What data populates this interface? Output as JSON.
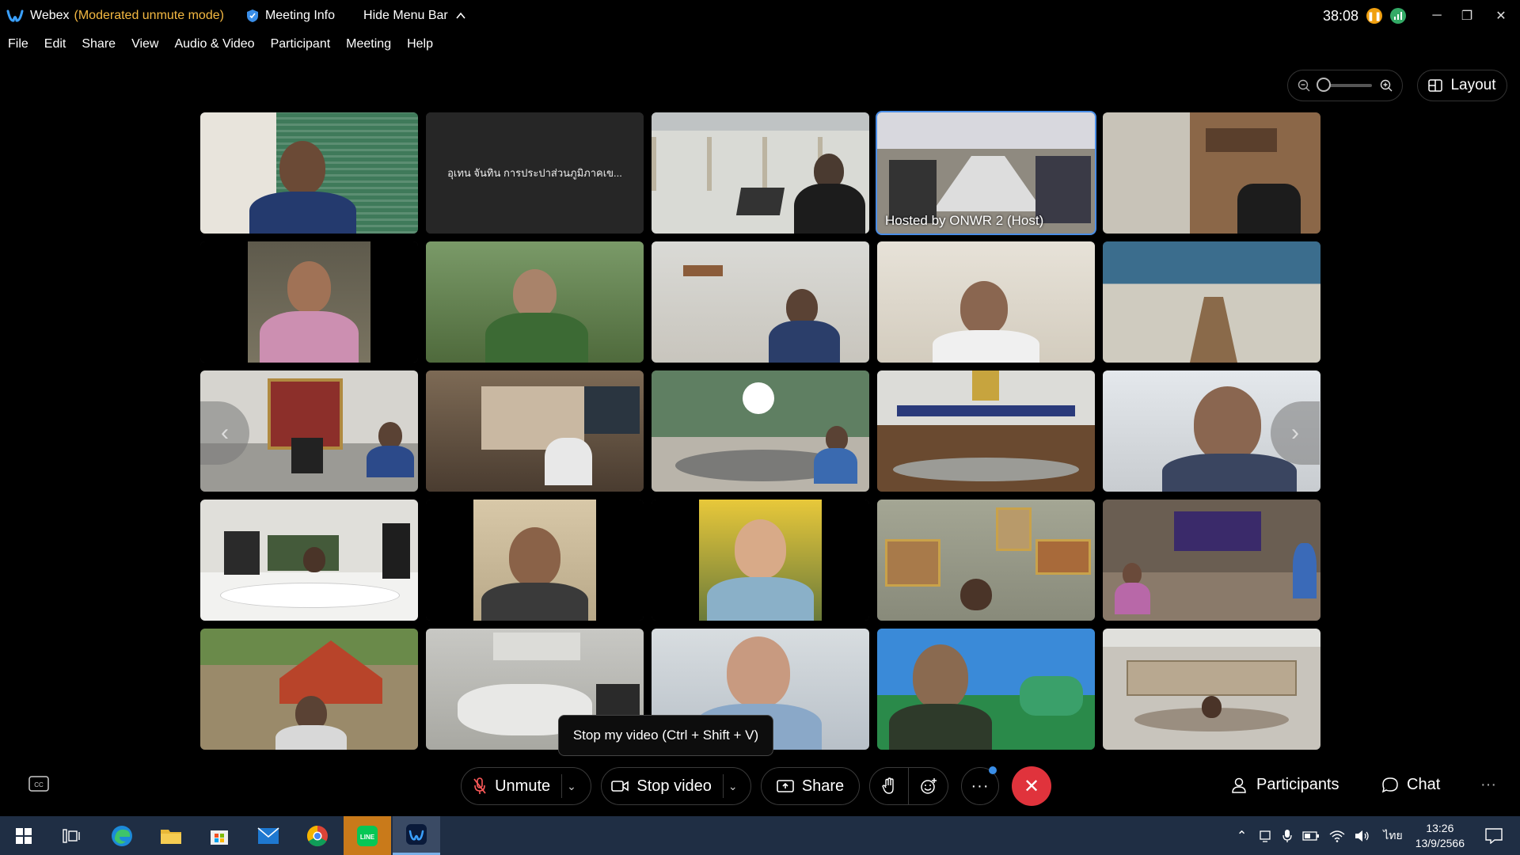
{
  "titlebar": {
    "app": "Webex",
    "mode": "(Moderated unmute mode)",
    "meeting_info": "Meeting Info",
    "hide_menu": "Hide Menu Bar",
    "timer": "38:08",
    "status_pause_color": "#f0a010",
    "status_signal_color": "#33aa66"
  },
  "menu": {
    "items": [
      "File",
      "Edit",
      "Share",
      "View",
      "Audio & Video",
      "Participant",
      "Meeting",
      "Help"
    ]
  },
  "toolbar": {
    "layout_label": "Layout"
  },
  "tiles": [
    {
      "type": "video",
      "label": ""
    },
    {
      "type": "name",
      "label": "อุเทน จันทิน การประปาส่วนภูมิภาคเข..."
    },
    {
      "type": "video",
      "label": ""
    },
    {
      "type": "video",
      "label": "Hosted by ONWR 2 (Host)",
      "active": true
    },
    {
      "type": "video",
      "label": ""
    },
    {
      "type": "video",
      "label": ""
    },
    {
      "type": "video",
      "label": ""
    },
    {
      "type": "video",
      "label": ""
    },
    {
      "type": "video",
      "label": ""
    },
    {
      "type": "video",
      "label": ""
    },
    {
      "type": "video",
      "label": ""
    },
    {
      "type": "video",
      "label": ""
    },
    {
      "type": "video",
      "label": ""
    },
    {
      "type": "video",
      "label": ""
    },
    {
      "type": "video",
      "label": ""
    },
    {
      "type": "video",
      "label": ""
    },
    {
      "type": "video",
      "label": ""
    },
    {
      "type": "video",
      "label": ""
    },
    {
      "type": "video",
      "label": ""
    },
    {
      "type": "video",
      "label": ""
    },
    {
      "type": "video",
      "label": ""
    },
    {
      "type": "video",
      "label": ""
    },
    {
      "type": "video",
      "label": ""
    },
    {
      "type": "video",
      "label": ""
    },
    {
      "type": "video",
      "label": ""
    }
  ],
  "tooltip": "Stop my video (Ctrl + Shift + V)",
  "controls": {
    "unmute": "Unmute",
    "stop_video": "Stop video",
    "share": "Share",
    "participants": "Participants",
    "chat": "Chat",
    "end_color": "#e0333c"
  },
  "taskbar": {
    "language": "ไทย",
    "time": "13:26",
    "date": "13/9/2566"
  }
}
